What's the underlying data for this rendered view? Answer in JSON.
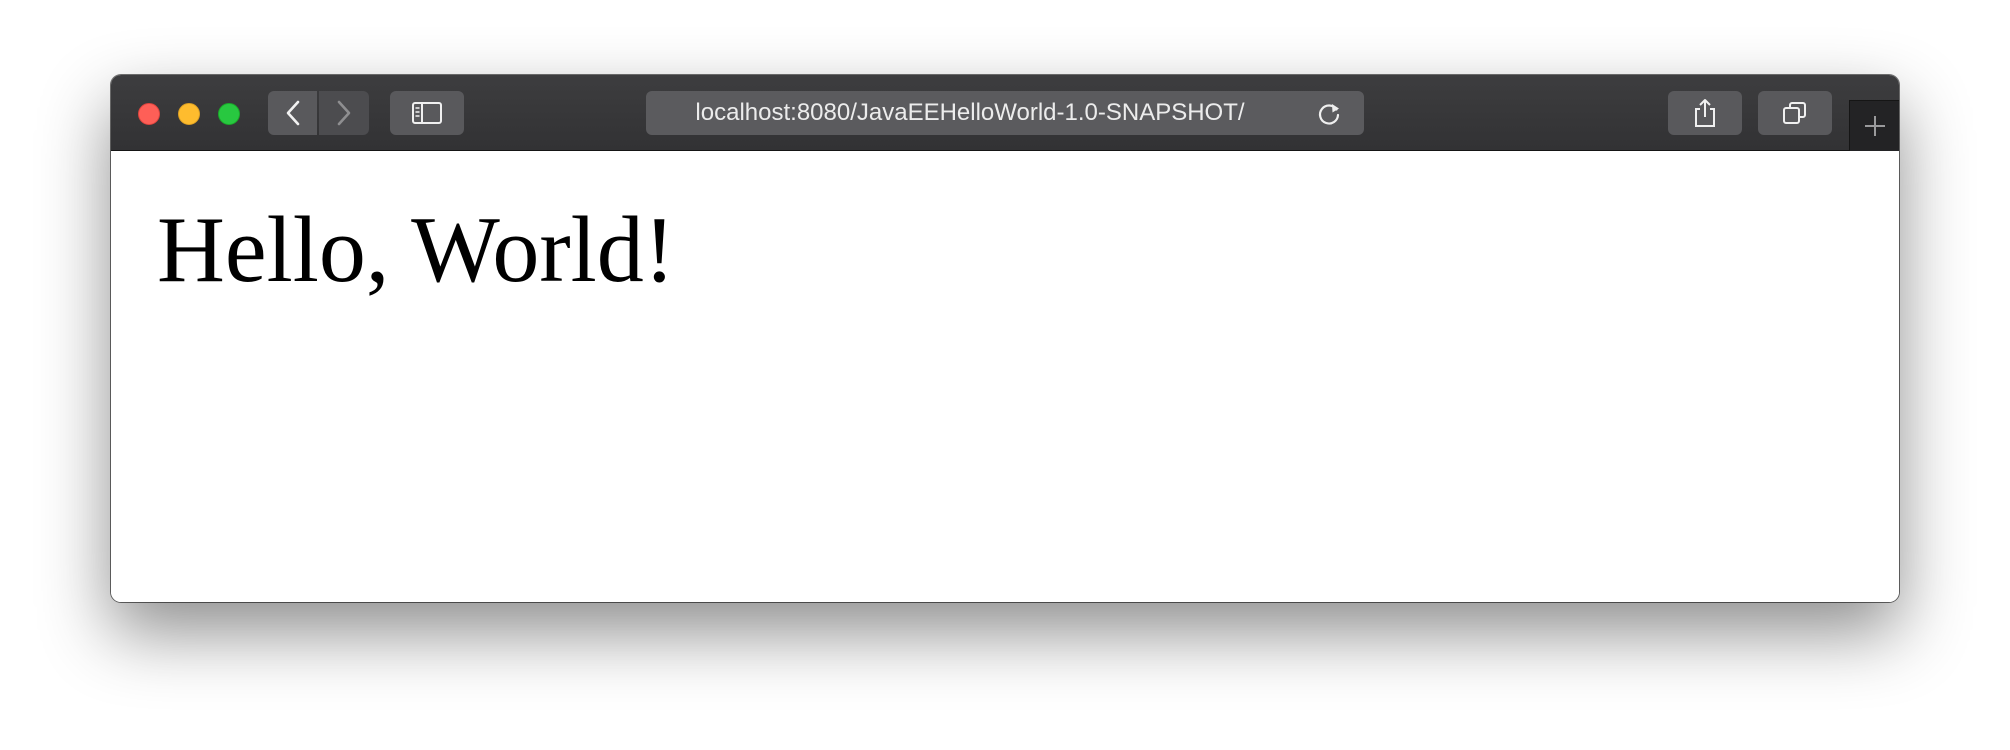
{
  "browser": {
    "toolbar": {
      "back_icon": "chevron-left-icon",
      "forward_icon": "chevron-right-icon",
      "sidebar_icon": "sidebar-icon",
      "share_icon": "share-icon",
      "tabs_icon": "tabs-overview-icon",
      "new_tab_icon": "plus-icon",
      "reload_icon": "reload-icon"
    },
    "address_bar": {
      "url": "localhost:8080/JavaEEHelloWorld-1.0-SNAPSHOT/"
    },
    "traffic_lights": {
      "close_color": "#fe5f57",
      "minimize_color": "#febc2e",
      "maximize_color": "#28c840"
    }
  },
  "page": {
    "heading": "Hello, World!"
  }
}
